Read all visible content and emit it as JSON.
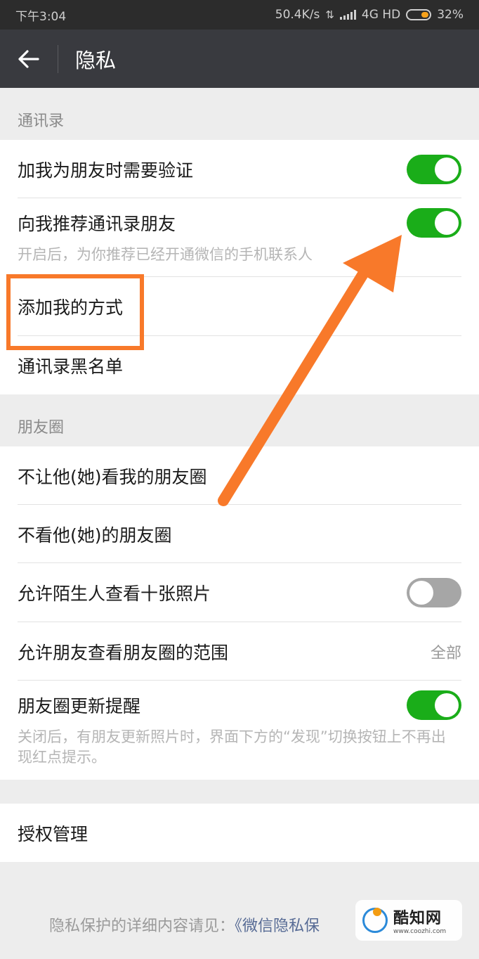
{
  "status": {
    "time": "下午3:04",
    "speed": "50.4K/s",
    "network": "4G HD",
    "battery": "32%"
  },
  "nav": {
    "title": "隐私"
  },
  "sections": {
    "contacts": {
      "title": "通讯录",
      "verify_label": "加我为朋友时需要验证",
      "verify_on": true,
      "recommend_label": "向我推荐通讯录朋友",
      "recommend_on": true,
      "recommend_desc": "开启后，为你推荐已经开通微信的手机联系人",
      "add_me_label": "添加我的方式",
      "blacklist_label": "通讯录黑名单"
    },
    "moments": {
      "title": "朋友圈",
      "hide_mine_label": "不让他(她)看我的朋友圈",
      "hide_theirs_label": "不看他(她)的朋友圈",
      "stranger_label": "允许陌生人查看十张照片",
      "stranger_on": false,
      "range_label": "允许朋友查看朋友圈的范围",
      "range_value": "全部",
      "update_label": "朋友圈更新提醒",
      "update_on": true,
      "update_desc": "关闭后，有朋友更新照片时，界面下方的“发现”切换按钮上不再出现红点提示。"
    },
    "auth": {
      "label": "授权管理"
    }
  },
  "footer": {
    "prefix": "隐私保护的详细内容请见：",
    "link": "《微信隐私保"
  },
  "watermark": {
    "name": "酷知网",
    "url": "www.coozhi.com"
  },
  "colors": {
    "toggle_on": "#1aad19",
    "toggle_off": "#a6a6a6",
    "annotation": "#f8792a",
    "nav_bg": "#393a3f"
  }
}
